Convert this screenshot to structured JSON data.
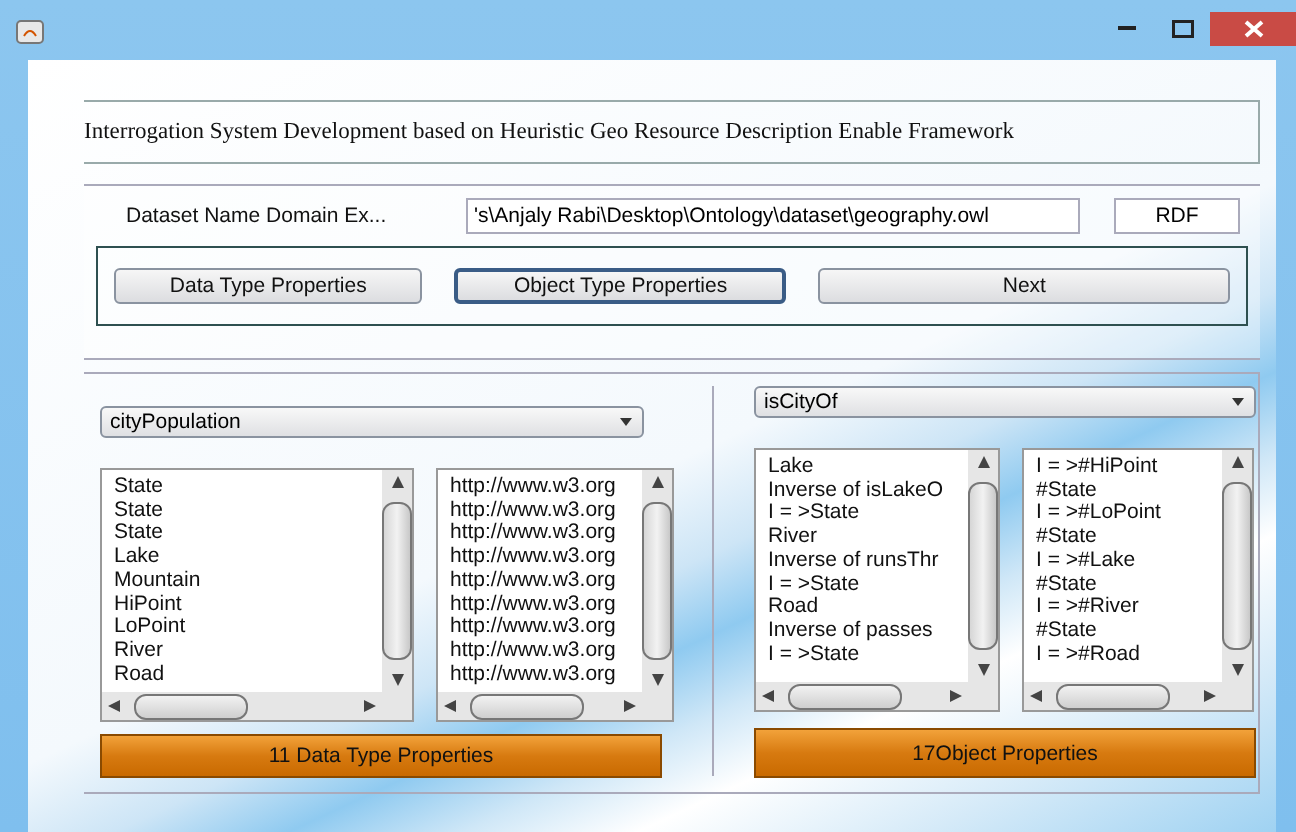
{
  "header": {
    "title": "Interrogation System Development based on Heuristic Geo Resource Description Enable Framework"
  },
  "dataset": {
    "label": "Dataset Name  Domain Ex...",
    "path": "'s\\Anjaly Rabi\\Desktop\\Ontology\\dataset\\geography.owl",
    "format": "RDF"
  },
  "buttons": [
    {
      "label": "Data Type Properties",
      "focused": false
    },
    {
      "label": "Object Type Properties",
      "focused": true
    },
    {
      "label": "Next",
      "focused": false
    }
  ],
  "data_type_panel": {
    "dropdown": "cityPopulation",
    "list_1": [
      "State",
      "State",
      "State",
      "Lake",
      "Mountain",
      "HiPoint",
      "LoPoint",
      "River",
      "Road"
    ],
    "list_2": [
      "http://www.w3.org",
      "http://www.w3.org",
      "http://www.w3.org",
      "http://www.w3.org",
      "http://www.w3.org",
      "http://www.w3.org",
      "http://www.w3.org",
      "http://www.w3.org",
      "http://www.w3.org"
    ],
    "summary": "11 Data Type Properties"
  },
  "object_panel": {
    "dropdown": "isCityOf",
    "list_1": [
      "Lake",
      "Inverse of isLakeO",
      "I = >State",
      "River",
      "Inverse of runsThr",
      "I = >State",
      "Road",
      "Inverse of passes",
      "I = >State"
    ],
    "list_2": [
      "I = >#HiPoint",
      "#State",
      "I = >#LoPoint",
      "#State",
      "I = >#Lake",
      "#State",
      "I = >#River",
      "#State",
      "I = >#Road"
    ],
    "summary": "17Object Properties"
  }
}
